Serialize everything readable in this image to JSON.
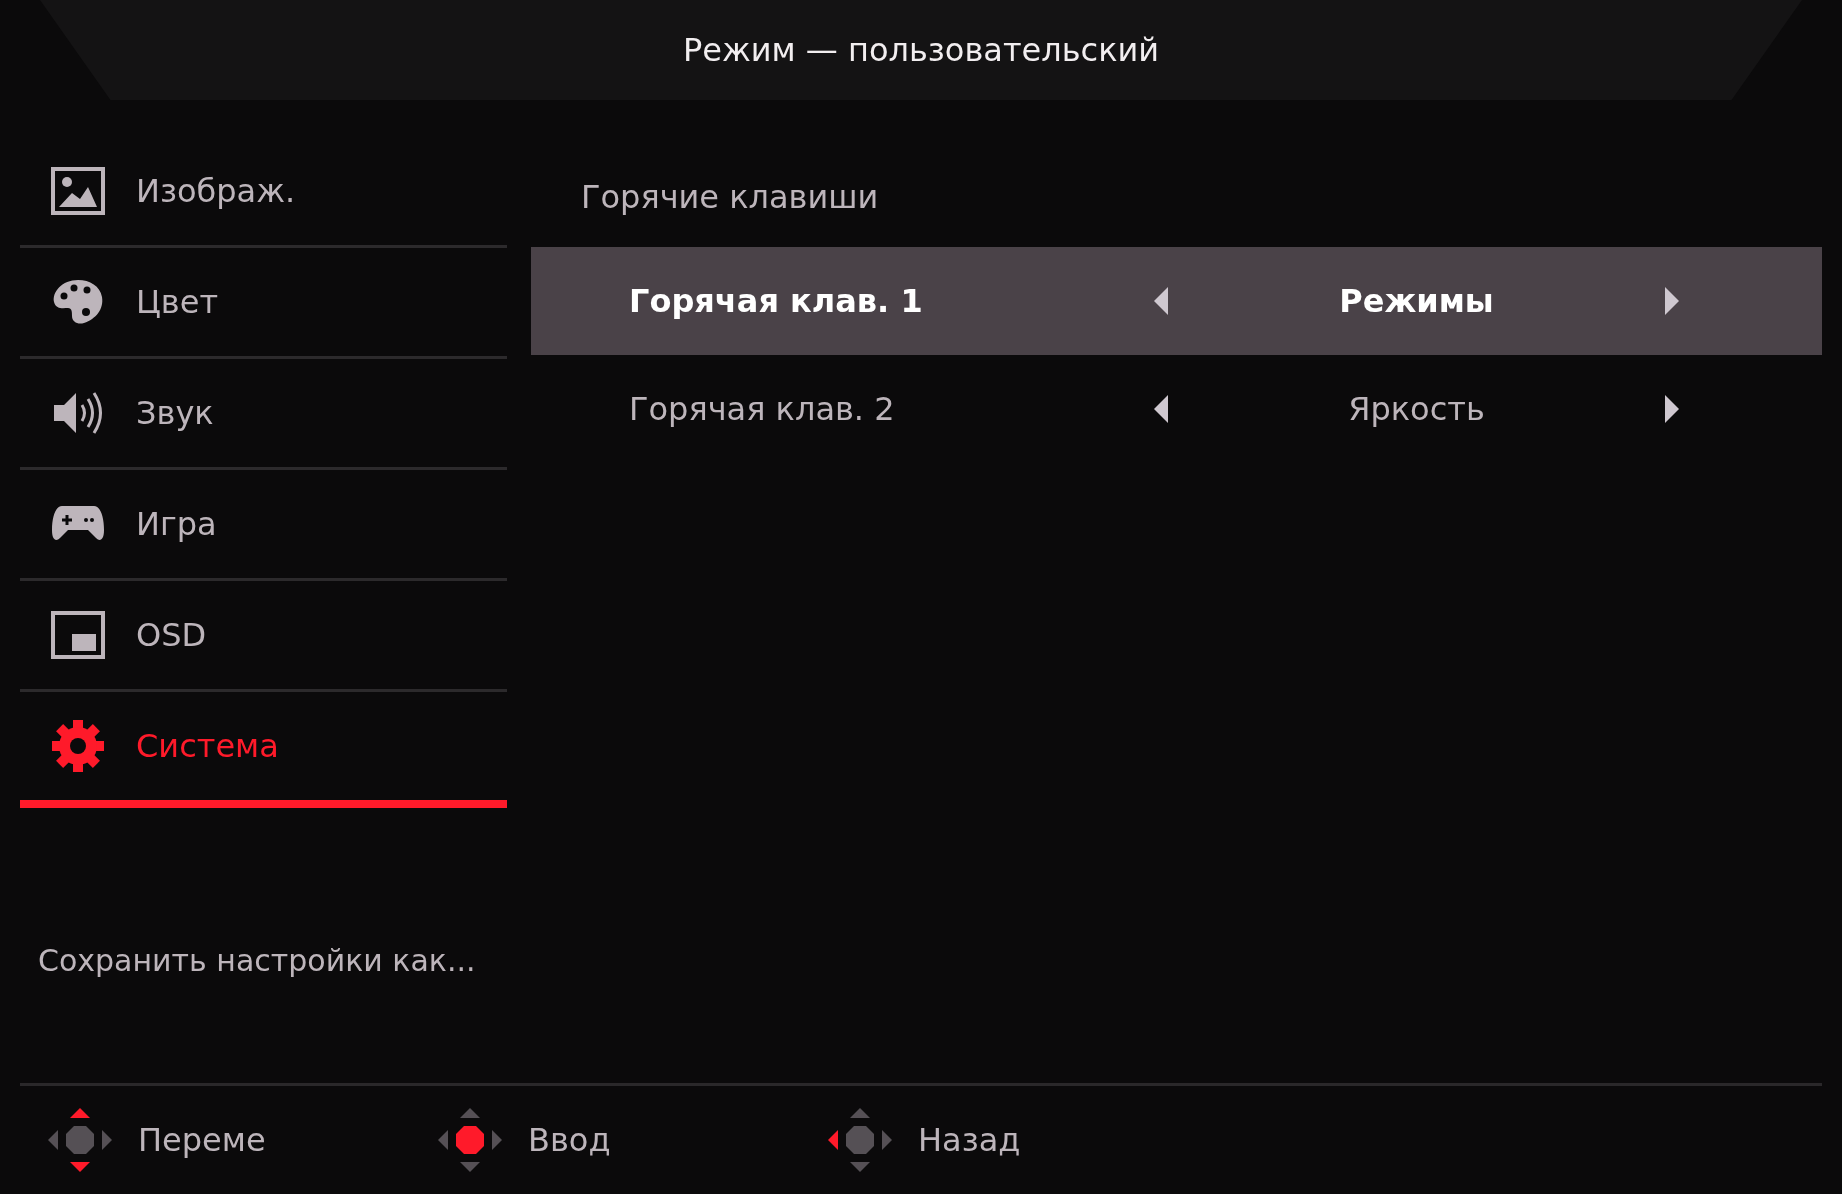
{
  "header": {
    "title": "Режим — пользовательский"
  },
  "sidebar": {
    "items": [
      {
        "kind": "image",
        "label": "Изображ.",
        "selected": false
      },
      {
        "kind": "palette",
        "label": "Цвет",
        "selected": false
      },
      {
        "kind": "speaker",
        "label": "Звук",
        "selected": false
      },
      {
        "kind": "gamepad",
        "label": "Игра",
        "selected": false
      },
      {
        "kind": "osd",
        "label": "OSD",
        "selected": false
      },
      {
        "kind": "gear",
        "label": "Система",
        "selected": true
      }
    ],
    "save_link": "Сохранить настройки как..."
  },
  "panel": {
    "title": "Горячие клавиши",
    "rows": [
      {
        "label": "Горячая клав. 1",
        "value": "Режимы",
        "selected": true
      },
      {
        "label": "Горячая клав. 2",
        "value": "Яркость",
        "selected": false
      }
    ]
  },
  "footer": {
    "hints": [
      {
        "kind": "vertical",
        "label": "Переме"
      },
      {
        "kind": "center",
        "label": "Ввод"
      },
      {
        "kind": "left",
        "label": "Назад"
      }
    ]
  }
}
